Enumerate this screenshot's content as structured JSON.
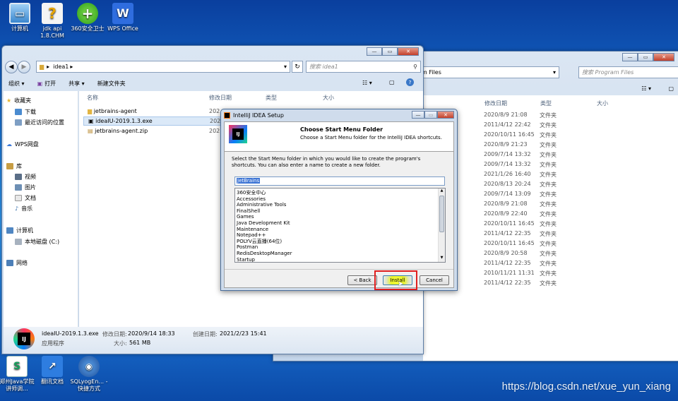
{
  "desktop": {
    "icons": [
      {
        "label": "计算机",
        "icon": "computer-icon"
      },
      {
        "label": "jdk api 1.8.CHM",
        "icon": "help-file-icon"
      },
      {
        "label": "360安全卫士",
        "icon": "360-security-icon"
      },
      {
        "label": "WPS Office",
        "icon": "wps-icon"
      }
    ],
    "bottom_icons": [
      {
        "label": "郑州Java学院讲师调...",
        "icon": "spreadsheet-icon"
      },
      {
        "label": "翻讯文档",
        "icon": "doc-shortcut-icon"
      },
      {
        "label": "SQLyogEn... - 快捷方式",
        "icon": "sqlyog-icon"
      }
    ],
    "watermark": "https://blog.csdn.net/xue_yun_xiang"
  },
  "explorer_left": {
    "path": "idea1",
    "search_placeholder": "搜索 idea1",
    "toolbar": {
      "organize": "组织 ▾",
      "open": "打开",
      "share": "共享 ▾",
      "new_folder": "新建文件夹"
    },
    "nav": {
      "favorites": "收藏夹",
      "downloads": "下载",
      "recent": "最近访问的位置",
      "wps_cloud": "WPS网盘",
      "libraries": "库",
      "videos": "视频",
      "pictures": "图片",
      "documents": "文档",
      "music": "音乐",
      "computer": "计算机",
      "local_disk": "本地磁盘 (C:)",
      "network": "网络"
    },
    "columns": {
      "name": "名称",
      "modified": "修改日期",
      "type": "类型",
      "size": "大小"
    },
    "files": [
      {
        "name": "jetbrains-agent",
        "date": "202",
        "icon": "folder-icon"
      },
      {
        "name": "ideaIU-2019.1.3.exe",
        "date": "202",
        "icon": "idea-exe-icon"
      },
      {
        "name": "jetbrains-agent.zip",
        "date": "202",
        "icon": "zip-icon"
      }
    ],
    "details": {
      "filename": "ideaIU-2019.1.3.exe",
      "type": "应用程序",
      "modified_label": "修改日期:",
      "modified_value": "2020/9/14 18:33",
      "created_label": "创建日期:",
      "created_value": "2021/2/23 15:41",
      "size_label": "大小:",
      "size_value": "561 MB"
    }
  },
  "explorer_right": {
    "path": "m Files",
    "search_placeholder": "搜索 Program Files",
    "columns": {
      "modified": "修改日期",
      "type": "类型",
      "size": "大小"
    },
    "rows": [
      {
        "date": "2020/8/9 21:08",
        "type": "文件夹"
      },
      {
        "date": "2011/4/12 22:42",
        "type": "文件夹"
      },
      {
        "date": "2020/10/11 16:45",
        "type": "文件夹"
      },
      {
        "date": "2020/8/9 21:23",
        "type": "文件夹"
      },
      {
        "date": "2009/7/14 13:32",
        "type": "文件夹"
      },
      {
        "date": "2009/7/14 13:32",
        "type": "文件夹"
      },
      {
        "date": "2021/1/26 16:40",
        "type": "文件夹"
      },
      {
        "date": "2020/8/13 20:24",
        "type": "文件夹"
      },
      {
        "date": "2009/7/14 13:09",
        "type": "文件夹"
      },
      {
        "date": "2020/8/9 21:08",
        "type": "文件夹"
      },
      {
        "date": "2020/8/9 22:40",
        "type": "文件夹"
      },
      {
        "date": "2020/10/11 16:45",
        "type": "文件夹"
      },
      {
        "date": "2011/4/12 22:35",
        "type": "文件夹"
      },
      {
        "date": "2020/10/11 16:45",
        "type": "文件夹"
      },
      {
        "date": "2020/8/9 20:58",
        "type": "文件夹"
      },
      {
        "date": "2011/4/12 22:35",
        "type": "文件夹"
      },
      {
        "date": "2010/11/21 11:31",
        "type": "文件夹"
      },
      {
        "date": "2011/4/12 22:35",
        "type": "文件夹"
      }
    ]
  },
  "setup": {
    "title": "IntelliJ IDEA Setup",
    "heading": "Choose Start Menu Folder",
    "subheading": "Choose a Start Menu folder for the IntelliJ IDEA shortcuts.",
    "instructions": "Select the Start Menu folder in which you would like to create the program's shortcuts. You can also enter a name to create a new folder.",
    "folder_value": "JetBrains",
    "folders": [
      "360安全中心",
      "Accessories",
      "Administrative Tools",
      "FinalShell",
      "Games",
      "Java Development Kit",
      "Maintenance",
      "Notepad++",
      "POLYV云直播(64位)",
      "Postman",
      "RedisDesktopManager",
      "Startup"
    ],
    "back_label": "< Back",
    "install_label": "Install",
    "cancel_label": "Cancel",
    "highlight_color": "#e02020"
  }
}
